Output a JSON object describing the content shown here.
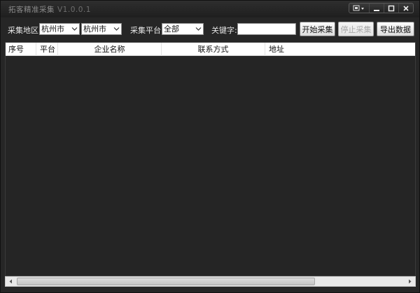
{
  "window": {
    "title": "拓客精准采集",
    "version": "V1.0.0.1"
  },
  "toolbar": {
    "region_label": "采集地区:",
    "province_value": "杭州市",
    "city_value": "杭州市",
    "platform_label": "采集平台:",
    "platform_value": "全部",
    "keyword_label": "关键字:",
    "keyword_value": "",
    "start_button": "开始采集",
    "stop_button": "停止采集",
    "export_button": "导出数据"
  },
  "table": {
    "columns": [
      "序号",
      "平台",
      "企业名称",
      "联系方式",
      "地址"
    ],
    "rows": []
  },
  "colors": {
    "background": "#262626",
    "titlebar": "#1f1f1f",
    "header_bg": "#ffffff"
  }
}
